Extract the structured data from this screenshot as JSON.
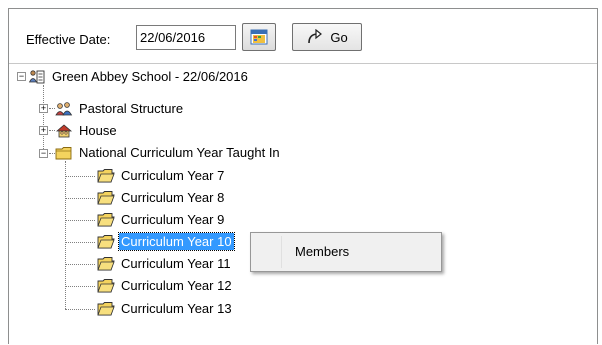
{
  "toolbar": {
    "effective_date_label": "Effective Date:",
    "effective_date_value": "22/06/2016",
    "go_label": "Go"
  },
  "tree": {
    "root": {
      "label": "Green Abbey School - 22/06/2016",
      "expanded": true
    },
    "nodes": [
      {
        "label": "Pastoral Structure",
        "expanded": false,
        "icon": "people-group-icon"
      },
      {
        "label": "House",
        "expanded": false,
        "icon": "house-group-icon"
      },
      {
        "label": "National Curriculum Year Taught In",
        "expanded": true,
        "icon": "folder-icon"
      }
    ],
    "curriculum_years": [
      {
        "label": "Curriculum Year  7"
      },
      {
        "label": "Curriculum Year  8"
      },
      {
        "label": "Curriculum Year  9"
      },
      {
        "label": "Curriculum Year 10",
        "selected": true
      },
      {
        "label": "Curriculum Year 11"
      },
      {
        "label": "Curriculum Year 12"
      },
      {
        "label": "Curriculum Year 13"
      }
    ]
  },
  "context_menu": {
    "items": [
      {
        "label": "Members"
      }
    ]
  },
  "colors": {
    "selection": "#3399ff",
    "folder": "#f4d35e",
    "menu_bg": "#f0f0f0"
  }
}
